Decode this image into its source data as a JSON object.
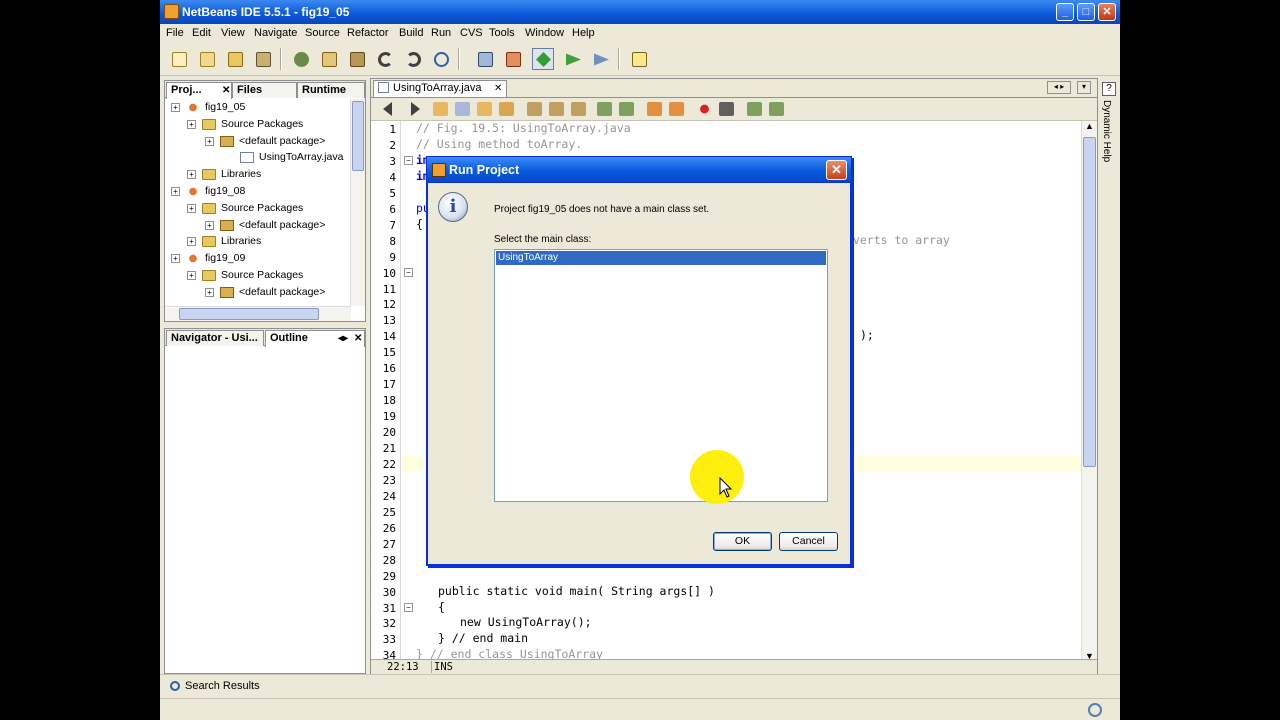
{
  "window": {
    "title": "NetBeans IDE 5.5.1 - fig19_05",
    "buttons": [
      "_",
      "□",
      "✕"
    ]
  },
  "menu": [
    "File",
    "Edit",
    "View",
    "Navigate",
    "Source",
    "Refactor",
    "Build",
    "Run",
    "CVS",
    "Tools",
    "Window",
    "Help"
  ],
  "projects_panel": {
    "tabs": [
      "Proj...",
      "Files",
      "Runtime"
    ],
    "tree": [
      {
        "label": "fig19_05",
        "icon": "project-icon",
        "level": 0
      },
      {
        "label": "Source Packages",
        "icon": "folder-icon",
        "level": 1
      },
      {
        "label": "<default package>",
        "icon": "package-icon",
        "level": 2
      },
      {
        "label": "UsingToArray.java",
        "icon": "java-file-icon",
        "level": 3
      },
      {
        "label": "Libraries",
        "icon": "folder-icon",
        "level": 1
      },
      {
        "label": "fig19_08",
        "icon": "project-icon",
        "level": 0
      },
      {
        "label": "Source Packages",
        "icon": "folder-icon",
        "level": 1
      },
      {
        "label": "<default package>",
        "icon": "package-icon",
        "level": 2
      },
      {
        "label": "Libraries",
        "icon": "folder-icon",
        "level": 1
      },
      {
        "label": "fig19_09",
        "icon": "project-icon",
        "level": 0
      },
      {
        "label": "Source Packages",
        "icon": "folder-icon",
        "level": 1
      },
      {
        "label": "<default package>",
        "icon": "package-icon",
        "level": 2
      }
    ]
  },
  "navigator_panel": {
    "tabs": [
      "Navigator - Usi...",
      "Outline"
    ]
  },
  "editor": {
    "file_tab": "UsingToArray.java",
    "line_numbers": [
      "1",
      "2",
      "3",
      "4",
      "5",
      "6",
      "7",
      "8",
      "9",
      "10",
      "11",
      "12",
      "13",
      "14",
      "15",
      "16",
      "17",
      "18",
      "19",
      "20",
      "21",
      "22",
      "23",
      "24",
      "25",
      "26",
      "27",
      "28",
      "29",
      "30",
      "31",
      "32",
      "33",
      "34"
    ],
    "code": {
      "l1": "// Fig. 19.5: UsingToArray.java",
      "l2": "// Using method toArray.",
      "l3": "im",
      "l4": "im",
      "l6": "pu",
      "l7": "{",
      "l8_tail": "nverts to array",
      "l14_tail": ");",
      "l30": "public static void main( String args[] )",
      "l31": "{",
      "l32": "new UsingToArray();",
      "l33": "} // end main",
      "l34": "} // end class UsingToArray"
    },
    "status_pos": "22:13",
    "status_mode": "INS"
  },
  "side_strip": "Dynamic Help",
  "bottom": {
    "search_results": "Search Results"
  },
  "dialog": {
    "title": "Run Project",
    "message": "Project fig19_05 does not have a main class set.",
    "select_label": "Select the main class:",
    "classes": [
      "UsingToArray"
    ],
    "selected": "UsingToArray",
    "ok": "OK",
    "cancel": "Cancel"
  }
}
